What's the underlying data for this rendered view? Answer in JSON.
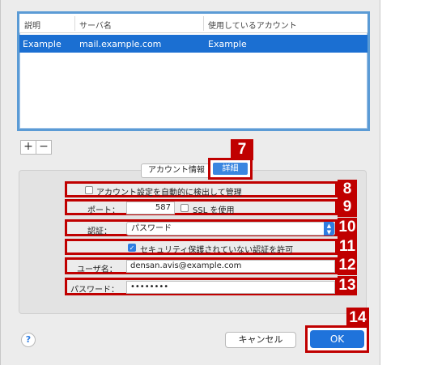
{
  "table": {
    "headers": [
      "説明",
      "サーバ名",
      "使用しているアカウント"
    ],
    "rows": [
      {
        "description": "Example",
        "server": "mail.example.com",
        "account": "Example"
      }
    ]
  },
  "buttons": {
    "add": "+",
    "remove": "−",
    "help": "?",
    "cancel": "キャンセル",
    "ok": "OK"
  },
  "tabs": {
    "account_info": "アカウント情報",
    "detail": "詳細"
  },
  "settings": {
    "auto_detect_label": "アカウント設定を自動的に検出して管理",
    "auto_detect_checked": false,
    "port_label": "ポート：",
    "port_value": "587",
    "ssl_label": "SSL を使用",
    "ssl_checked": false,
    "auth_label": "認証：",
    "auth_value": "パスワード",
    "allow_insecure_label": "セキュリティ保護されていない認証を許可",
    "allow_insecure_checked": true,
    "username_label": "ユーザ名：",
    "username_value": "densan.avis@example.com",
    "password_label": "パスワード：",
    "password_value": "••••••••"
  },
  "markers": [
    "7",
    "8",
    "9",
    "10",
    "11",
    "12",
    "13",
    "14"
  ],
  "colors": {
    "marker_red": "#c00000",
    "selection_blue": "#1b6fd2",
    "accent_blue": "#2f7de1"
  }
}
